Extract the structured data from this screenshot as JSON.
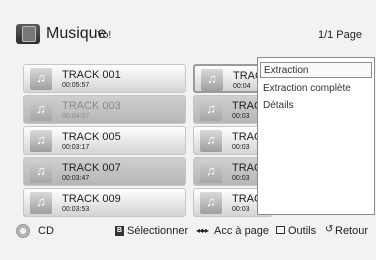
{
  "header": {
    "title": "Musique",
    "subtitle": "Yo!",
    "page_indicator": "1/1 Page",
    "icon": "music-folder-icon"
  },
  "tracks_left": [
    {
      "name": "TRACK 001",
      "duration": "00:05:57"
    },
    {
      "name": "TRACK 003",
      "duration": "00:04:07"
    },
    {
      "name": "TRACK 005",
      "duration": "00:03:17"
    },
    {
      "name": "TRACK 007",
      "duration": "00:03:47"
    },
    {
      "name": "TRACK 009",
      "duration": "00:03:53"
    }
  ],
  "tracks_right": [
    {
      "name": "TRAC",
      "duration": "00:04"
    },
    {
      "name": "TRAC",
      "duration": "00:03"
    },
    {
      "name": "TRAC",
      "duration": "00:03"
    },
    {
      "name": "TRAC",
      "duration": "00:03"
    },
    {
      "name": "TRAC",
      "duration": "00:03"
    }
  ],
  "tools_menu": {
    "items": [
      "Extraction",
      "Extraction complète",
      "Détails"
    ],
    "selected": "Extraction"
  },
  "footer": {
    "source": "CD",
    "select_key": "B",
    "select_label": "Sélectionner",
    "skip_label": "Acc à page",
    "tools_label": "Outils",
    "return_label": "Retour"
  },
  "colors": {
    "background": "#f2f2f2",
    "row_light": "#e6e6e6",
    "row_dark": "#c2c2c2",
    "menu_bg": "#ffffff"
  }
}
